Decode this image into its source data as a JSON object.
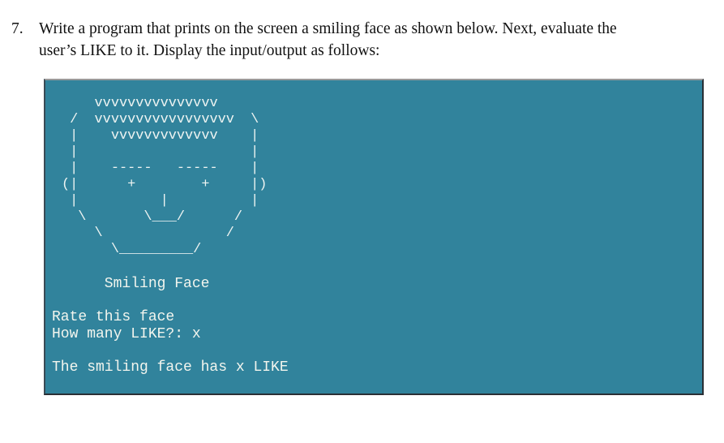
{
  "question": {
    "number": "7.",
    "line1": "Write a program that prints on the screen a smiling face as shown below. Next, evaluate the",
    "line2": "user’s LIKE to it. Display the input/output as follows:"
  },
  "console": {
    "background_color": "#31839c",
    "text_color": "#eef4f2",
    "face_lines": [
      "    vvvvvvvvvvvvvvv",
      " /  vvvvvvvvvvvvvvvvv  \\",
      " |    vvvvvvvvvvvvv    |",
      " |                     |",
      " |    -----   -----    |",
      "(|      +        +     |)",
      " |          |          |",
      "  \\       \\___/      /",
      "    \\               /",
      "      \\_________/"
    ],
    "output_lines": [
      "      Smiling Face",
      "",
      "Rate this face",
      "How many LIKE?: x",
      "",
      "The smiling face has x LIKE"
    ]
  }
}
